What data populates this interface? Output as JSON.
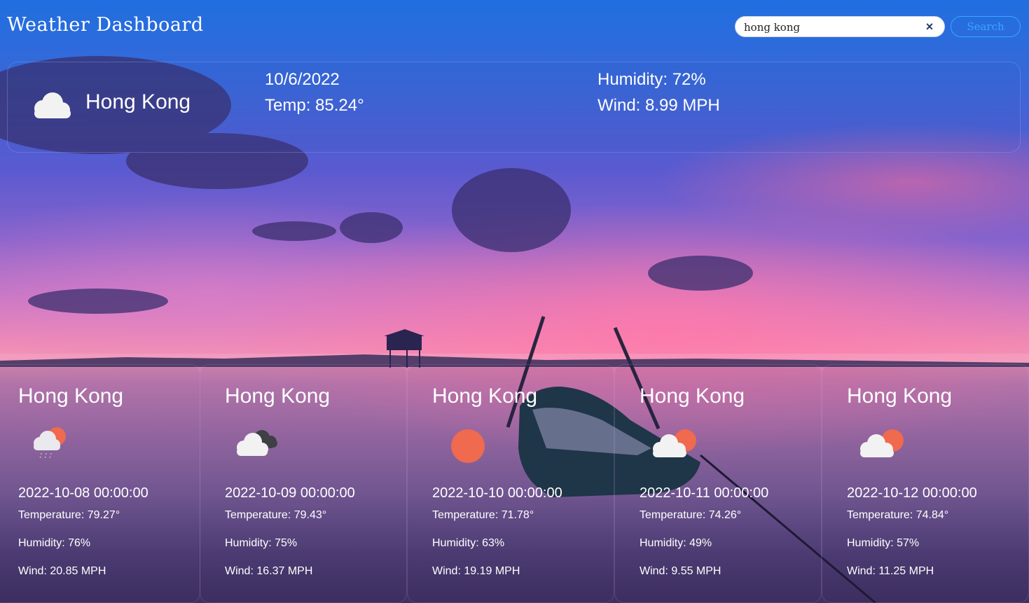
{
  "app": {
    "title": "Weather Dashboard"
  },
  "search": {
    "value": "hong kong",
    "button_label": "Search",
    "clear_icon": "×"
  },
  "current": {
    "icon": "cloud-icon",
    "city": "Hong Kong",
    "date": "10/6/2022",
    "temp": "Temp: 85.24°",
    "humidity": "Humidity: 72%",
    "wind": "Wind: 8.99 MPH"
  },
  "forecast": [
    {
      "city": "Hong Kong",
      "icon": "sun-cloud-rain-icon",
      "date": "2022-10-08 00:00:00",
      "temp": "Temperature: 79.27°",
      "humidity": "Humidity: 76%",
      "wind": "Wind: 20.85 MPH"
    },
    {
      "city": "Hong Kong",
      "icon": "broken-clouds-icon",
      "date": "2022-10-09 00:00:00",
      "temp": "Temperature: 79.43°",
      "humidity": "Humidity: 75%",
      "wind": "Wind: 16.37 MPH"
    },
    {
      "city": "Hong Kong",
      "icon": "sun-icon",
      "date": "2022-10-10 00:00:00",
      "temp": "Temperature: 71.78°",
      "humidity": "Humidity: 63%",
      "wind": "Wind: 19.19 MPH"
    },
    {
      "city": "Hong Kong",
      "icon": "sun-cloud-icon",
      "date": "2022-10-11 00:00:00",
      "temp": "Temperature: 74.26°",
      "humidity": "Humidity: 49%",
      "wind": "Wind: 9.55 MPH"
    },
    {
      "city": "Hong Kong",
      "icon": "sun-cloud-icon",
      "date": "2022-10-12 00:00:00",
      "temp": "Temperature: 74.84°",
      "humidity": "Humidity: 57%",
      "wind": "Wind: 11.25 MPH"
    }
  ],
  "colors": {
    "accent": "#3aa6ff",
    "sun": "#ef6a4e"
  }
}
